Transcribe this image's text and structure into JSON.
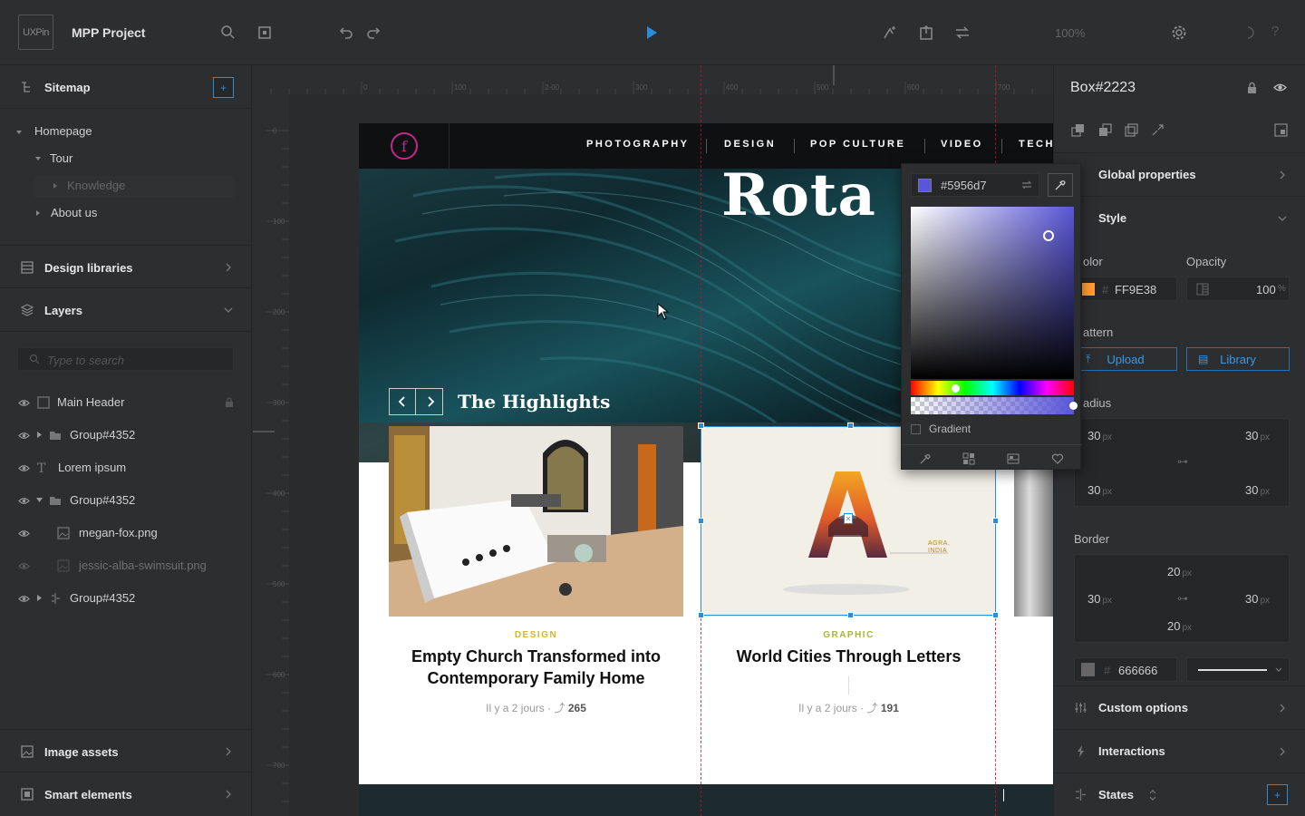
{
  "app": {
    "logo_text": "UXPin",
    "project_name": "MPP Project",
    "zoom": "100%"
  },
  "left": {
    "sitemap_label": "Sitemap",
    "sitemap_add": "+",
    "tree": [
      "Homepage",
      "Tour",
      "Knowledge",
      "About us"
    ],
    "design_libraries_label": "Design libraries",
    "layers_label": "Layers",
    "search_placeholder": "Type to search",
    "layers": [
      {
        "name": "Main Header",
        "icon": "rectangle-icon"
      },
      {
        "name": "Group#4352",
        "icon": "folder-icon"
      },
      {
        "name": "Lorem ipsum",
        "icon": "text-icon"
      },
      {
        "name": "Group#4352",
        "icon": "folder-icon"
      },
      {
        "name": "megan-fox.png",
        "icon": "image-icon"
      },
      {
        "name": "jessic-alba-swimsuit.png",
        "icon": "image-icon"
      },
      {
        "name": "Group#4352",
        "icon": "component-icon"
      }
    ],
    "image_assets_label": "Image assets",
    "smart_elements_label": "Smart elements"
  },
  "ruler": {
    "top": [
      "0",
      "100",
      "2-00",
      "300",
      "400",
      "500",
      "600",
      "700"
    ],
    "left": [
      "0",
      "100",
      "200",
      "300",
      "400",
      "500",
      "600",
      "700"
    ]
  },
  "artboard": {
    "nav": [
      "PHOTOGRAPHY",
      "DESIGN",
      "POP CULTURE",
      "VIDEO",
      "TECH"
    ],
    "logo_letter": "f",
    "hero_title": "Rota",
    "highlights_title": "The Highlights",
    "cards": [
      {
        "category": "DESIGN",
        "title": "Empty Church Transformed into Contemporary Family Home",
        "time": "Il y a 2 jours",
        "shares": "265"
      },
      {
        "category": "GRAPHIC",
        "title": "World Cities Through Letters",
        "time": "Il y a 2 jours",
        "shares": "191",
        "art_letter": "A",
        "art_caption": "AGRA, INDIA"
      }
    ]
  },
  "picker": {
    "hex": "#5956d7",
    "gradient_label": "Gradient"
  },
  "right": {
    "element_name": "Box#2223",
    "global_properties": "Global properties",
    "style": "Style",
    "color_label": "olor",
    "opacity_label": "Opacity",
    "color_hex": "FF9E38",
    "hash": "#",
    "opacity_value": "100",
    "opacity_unit": "%",
    "pattern_label": "attern",
    "upload": "Upload",
    "library": "Library",
    "radius_label": "adius",
    "radius": {
      "tl": "30",
      "tr": "30",
      "bl": "30",
      "br": "30"
    },
    "border_label": "Border",
    "border": {
      "top": "20",
      "left": "30",
      "right": "30",
      "bottom": "20"
    },
    "border_color": "666666",
    "unit": "px",
    "custom_options": "Custom options",
    "interactions": "Interactions",
    "states": "States",
    "states_add": "+"
  },
  "colors": {
    "accent": "#2a8cdb",
    "picked": "#5956d7",
    "swatch": "#FF9E38",
    "border_swatch": "#666666",
    "design_cat": "#d7b52b",
    "graphic_cat": "#a8b43a"
  }
}
